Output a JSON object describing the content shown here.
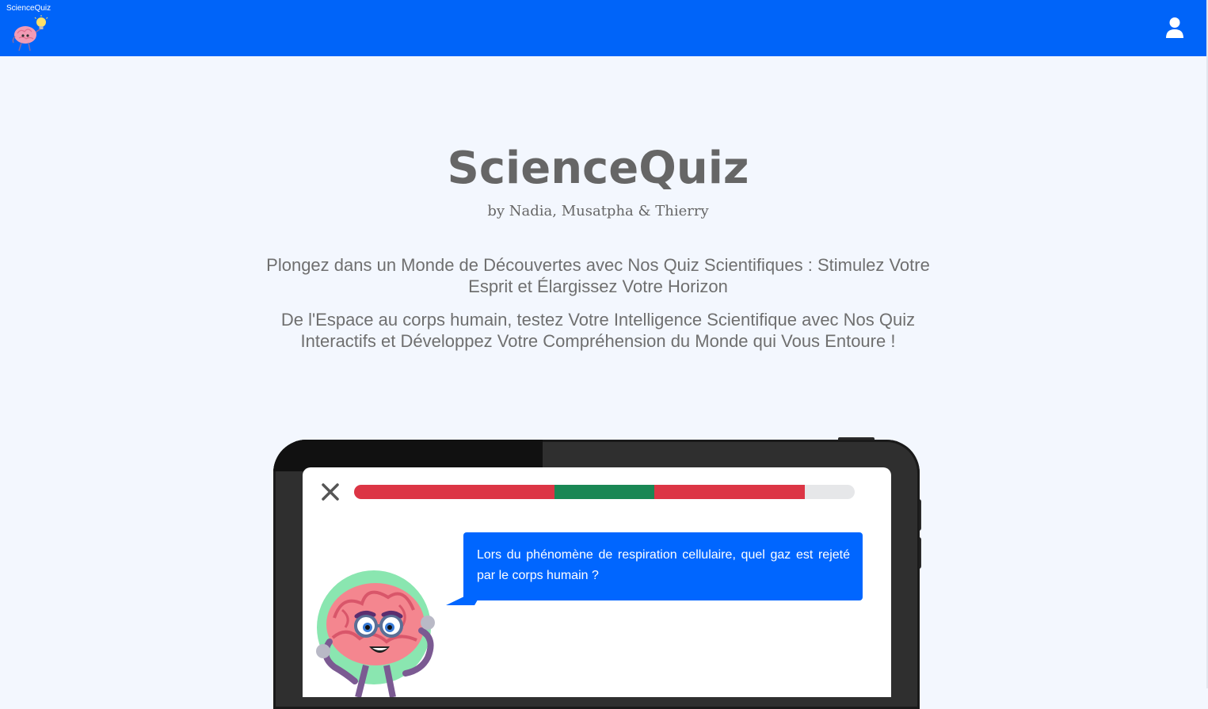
{
  "navbar": {
    "brand": "ScienceQuiz",
    "background": "#0064f9",
    "logo_icon": "brain-mascot-lightbulb",
    "user_icon": "user-icon"
  },
  "hero": {
    "title": "ScienceQuiz",
    "authors": "by Nadia, Musatpha & Thierry",
    "paragraph_1": "Plongez dans un Monde de Découvertes avec Nos Quiz Scientifiques : Stimulez Votre Esprit et Élargissez Votre Horizon",
    "paragraph_2": "De l'Espace au corps humain, testez Votre Intelligence Scientifique avec Nos Quiz Interactifs et Développez Votre Compréhension du Monde qui Vous Entoure !"
  },
  "preview": {
    "close_icon": "close-icon",
    "question": "Lors du phénomène de respiration cellulaire, quel gaz est rejeté par le corps humain ?",
    "progress_segments": [
      {
        "status": "wrong",
        "color": "#dc3545",
        "fraction": 0.4
      },
      {
        "status": "correct",
        "color": "#198754",
        "fraction": 0.2
      },
      {
        "status": "wrong",
        "color": "#dc3545",
        "fraction": 0.3
      }
    ],
    "progress_track_color": "#e6e7e9",
    "bubble_color": "#0066ff",
    "mascot_icon": "brain-mascot-glasses"
  }
}
